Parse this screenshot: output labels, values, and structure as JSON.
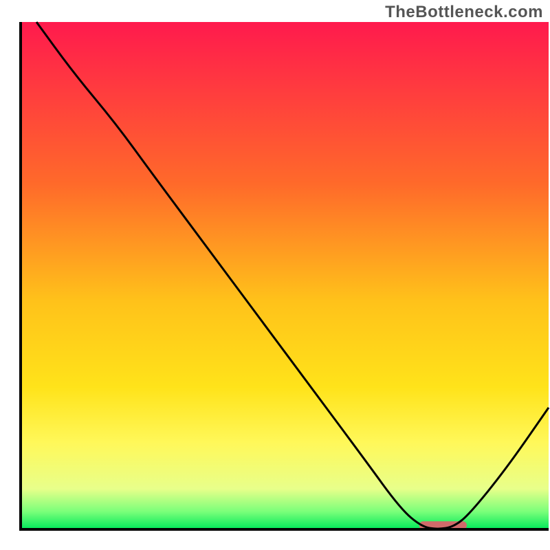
{
  "attribution": "TheBottleneck.com",
  "chart_data": {
    "type": "line",
    "title": "",
    "xlabel": "",
    "ylabel": "",
    "xlim": [
      0,
      100
    ],
    "ylim": [
      0,
      100
    ],
    "grid": false,
    "legend": false,
    "gradient_stops": [
      {
        "offset": 0.0,
        "color": "#ff1a4d"
      },
      {
        "offset": 0.32,
        "color": "#ff6a2a"
      },
      {
        "offset": 0.55,
        "color": "#ffc21a"
      },
      {
        "offset": 0.72,
        "color": "#ffe31a"
      },
      {
        "offset": 0.83,
        "color": "#fff85a"
      },
      {
        "offset": 0.92,
        "color": "#e8ff8a"
      },
      {
        "offset": 0.965,
        "color": "#7aff7a"
      },
      {
        "offset": 1.0,
        "color": "#00e85a"
      }
    ],
    "series": [
      {
        "name": "bottleneck-curve",
        "color": "#000000",
        "x": [
          3,
          10,
          18,
          25,
          35,
          45,
          55,
          65,
          72,
          76,
          79,
          82,
          85,
          92,
          100
        ],
        "y": [
          100,
          90,
          80,
          70,
          56,
          42,
          28,
          14,
          4,
          0.5,
          0,
          0.5,
          3,
          12,
          24
        ]
      }
    ],
    "highlight_bar": {
      "x_start": 75.5,
      "x_end": 84.5,
      "y": 0.8,
      "thickness": 1.6,
      "color": "#d06a6a"
    }
  }
}
